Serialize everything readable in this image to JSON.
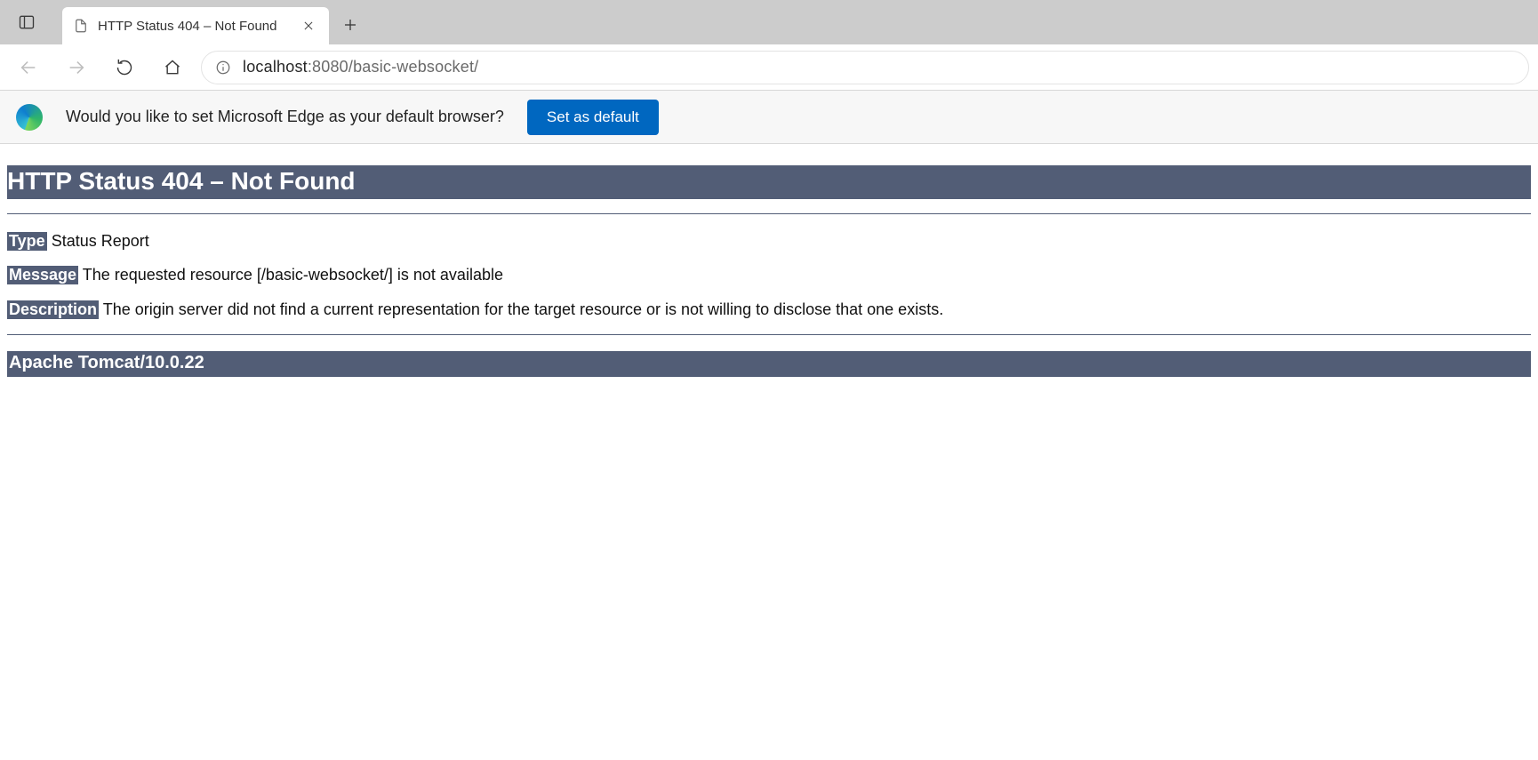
{
  "browser": {
    "tab_title": "HTTP Status 404 – Not Found",
    "url_host": "localhost",
    "url_path": ":8080/basic-websocket/"
  },
  "infobar": {
    "message": "Would you like to set Microsoft Edge as your default browser?",
    "button_label": "Set as default"
  },
  "error_page": {
    "heading": "HTTP Status 404 – Not Found",
    "type_label": "Type",
    "type_value": " Status Report",
    "message_label": "Message",
    "message_value": " The requested resource [/basic-websocket/] is not available",
    "description_label": "Description",
    "description_value": " The origin server did not find a current representation for the target resource or is not willing to disclose that one exists.",
    "server_line": "Apache Tomcat/10.0.22"
  }
}
